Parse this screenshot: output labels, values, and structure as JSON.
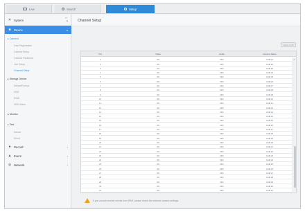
{
  "tabs": {
    "live": "Live",
    "search": "Search",
    "setup": "Setup"
  },
  "sidebar": {
    "system": "System",
    "device": "Device",
    "camera_group": "Camera",
    "camera_items": [
      "Cam Registration",
      "Camera Setup",
      "Camera Password",
      "Live Setup",
      "Channel Setup"
    ],
    "storage_group": "Storage Device",
    "storage_items": [
      "Device/Format",
      "HDD",
      "RAID",
      "HDD Alarm"
    ],
    "monitor": "Monitor",
    "text_group": "Text",
    "text_items": [
      "Device",
      "Event"
    ],
    "record": "Record",
    "event": "Event",
    "network": "Network"
  },
  "page": {
    "title": "Channel Setup",
    "apply_label": "Apply to All",
    "warning": "If you cannot receive events from RAR, please check the network camera settings."
  },
  "table": {
    "headers": [
      "CH",
      "Video",
      "Audio",
      "Camera Name"
    ],
    "rows": [
      [
        "1",
        "ON",
        "OFF",
        "CAM 01"
      ],
      [
        "2",
        "ON",
        "OFF",
        "CAM 02"
      ],
      [
        "3",
        "ON",
        "OFF",
        "CAM 03"
      ],
      [
        "4",
        "ON",
        "OFF",
        "CAM 04"
      ],
      [
        "5",
        "ON",
        "OFF",
        "CAM 05"
      ],
      [
        "6",
        "ON",
        "OFF",
        "CAM 06"
      ],
      [
        "7",
        "ON",
        "OFF",
        "CAM 07"
      ],
      [
        "8",
        "ON",
        "OFF",
        "CAM 08"
      ],
      [
        "9",
        "ON",
        "OFF",
        "CAM 09"
      ],
      [
        "10",
        "ON",
        "OFF",
        "CAM 10"
      ],
      [
        "11",
        "ON",
        "OFF",
        "CAM 11"
      ],
      [
        "12",
        "ON",
        "OFF",
        "CAM 12"
      ],
      [
        "13",
        "ON",
        "OFF",
        "CAM 13"
      ],
      [
        "14",
        "ON",
        "OFF",
        "CAM 14"
      ],
      [
        "15",
        "ON",
        "OFF",
        "CAM 15"
      ],
      [
        "16",
        "ON",
        "OFF",
        "CAM 16"
      ],
      [
        "17",
        "ON",
        "OFF",
        "CAM 17"
      ],
      [
        "18",
        "ON",
        "OFF",
        "CAM 18"
      ],
      [
        "19",
        "ON",
        "OFF",
        "CAM 19"
      ],
      [
        "20",
        "ON",
        "OFF",
        "CAM 20"
      ],
      [
        "21",
        "ON",
        "OFF",
        "CAM 21"
      ],
      [
        "22",
        "ON",
        "OFF",
        "CAM 22"
      ],
      [
        "23",
        "ON",
        "OFF",
        "CAM 23"
      ],
      [
        "24",
        "ON",
        "OFF",
        "CAM 24"
      ],
      [
        "25",
        "ON",
        "OFF",
        "CAM 25"
      ],
      [
        "26",
        "ON",
        "OFF",
        "CAM 26"
      ],
      [
        "27",
        "ON",
        "OFF",
        "CAM 27"
      ],
      [
        "28",
        "ON",
        "OFF",
        "CAM 28"
      ],
      [
        "29",
        "ON",
        "OFF",
        "CAM 29"
      ],
      [
        "30",
        "ON",
        "OFF",
        "CAM 30"
      ],
      [
        "31",
        "ON",
        "OFF",
        "CAM 31"
      ]
    ]
  },
  "colors": {
    "accent": "#3a8ee6",
    "warning": "#f0a31a"
  }
}
